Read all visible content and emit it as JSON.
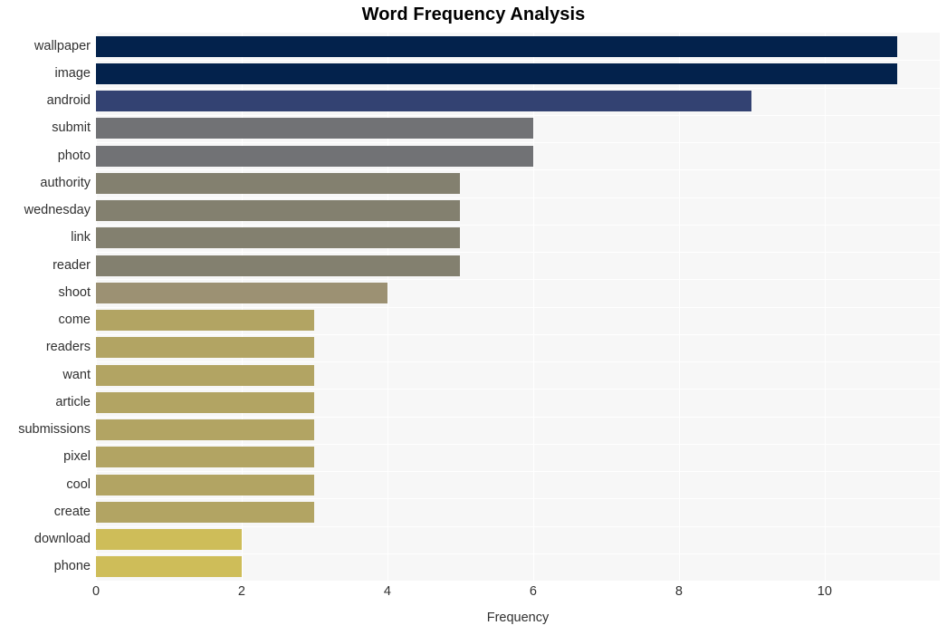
{
  "chart_data": {
    "type": "bar",
    "orientation": "horizontal",
    "title": "Word Frequency Analysis",
    "xlabel": "Frequency",
    "ylabel": "",
    "categories": [
      "wallpaper",
      "image",
      "android",
      "submit",
      "photo",
      "authority",
      "wednesday",
      "link",
      "reader",
      "shoot",
      "come",
      "readers",
      "want",
      "article",
      "submissions",
      "pixel",
      "cool",
      "create",
      "download",
      "phone"
    ],
    "values": [
      11,
      11,
      9,
      6,
      6,
      5,
      5,
      5,
      5,
      4,
      3,
      3,
      3,
      3,
      3,
      3,
      3,
      3,
      2,
      2
    ],
    "bar_colors": [
      "#03224c",
      "#03224c",
      "#334272",
      "#717275",
      "#717275",
      "#83806f",
      "#83806f",
      "#83806f",
      "#83806f",
      "#9c9173",
      "#b2a463",
      "#b2a463",
      "#b2a463",
      "#b2a463",
      "#b2a463",
      "#b2a463",
      "#b2a463",
      "#b2a463",
      "#cebd59",
      "#cebd59"
    ],
    "xlim": [
      0,
      11.58
    ],
    "xticks": [
      0,
      2,
      4,
      6,
      8,
      10
    ],
    "xtick_labels": [
      "0",
      "2",
      "4",
      "6",
      "8",
      "10"
    ],
    "grid": true,
    "grid_color": "#ffffff",
    "plot_background": "#f7f7f7",
    "figure_background": "#ffffff",
    "legend": null,
    "title_color": "#000000",
    "tick_label_color": "#303030"
  }
}
